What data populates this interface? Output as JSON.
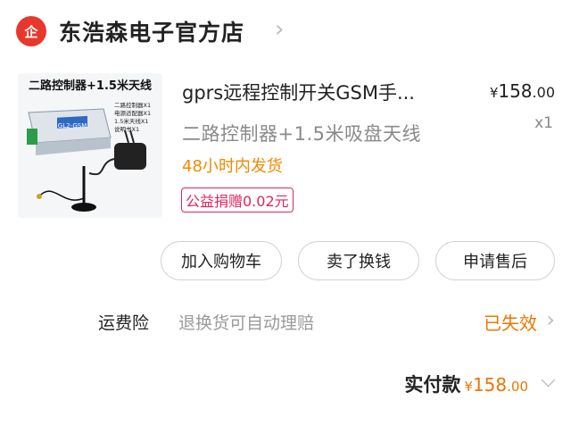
{
  "shop": {
    "badge_text": "企",
    "name": "东浩森电子官方店",
    "chevron_icon": "chevron-right-icon"
  },
  "product": {
    "image_caption": "二路控制器+1.5米天线",
    "image_module_label": "GL2-GSM",
    "image_contents": [
      "二路控制器X1",
      "电源适配器X1",
      "1.5米天线X1",
      "说明书X1"
    ],
    "title": "gprs远程控制开关GSM手机控制",
    "title_display": "gprs远程控制开关GSM手...",
    "spec": "二路控制器+1.5米吸盘天线",
    "shipping_note": "48小时内发货",
    "charity_badge": "公益捐赠0.02元",
    "price_symbol": "¥",
    "price_int": "158",
    "price_dec": ".00",
    "quantity": "x1"
  },
  "actions": {
    "add_to_cart": "加入购物车",
    "resell": "卖了换钱",
    "after_sales": "申请售后"
  },
  "insurance": {
    "label": "运费险",
    "description": "退换货可自动理赔",
    "status": "已失效"
  },
  "total": {
    "label": "实付款",
    "symbol": "¥",
    "amount_int": "158",
    "amount_dec": ".00"
  },
  "colors": {
    "brand_red": "#e8382d",
    "accent_orange": "#f07400",
    "shipping_orange": "#f08a00",
    "charity_pink": "#e0245e"
  }
}
